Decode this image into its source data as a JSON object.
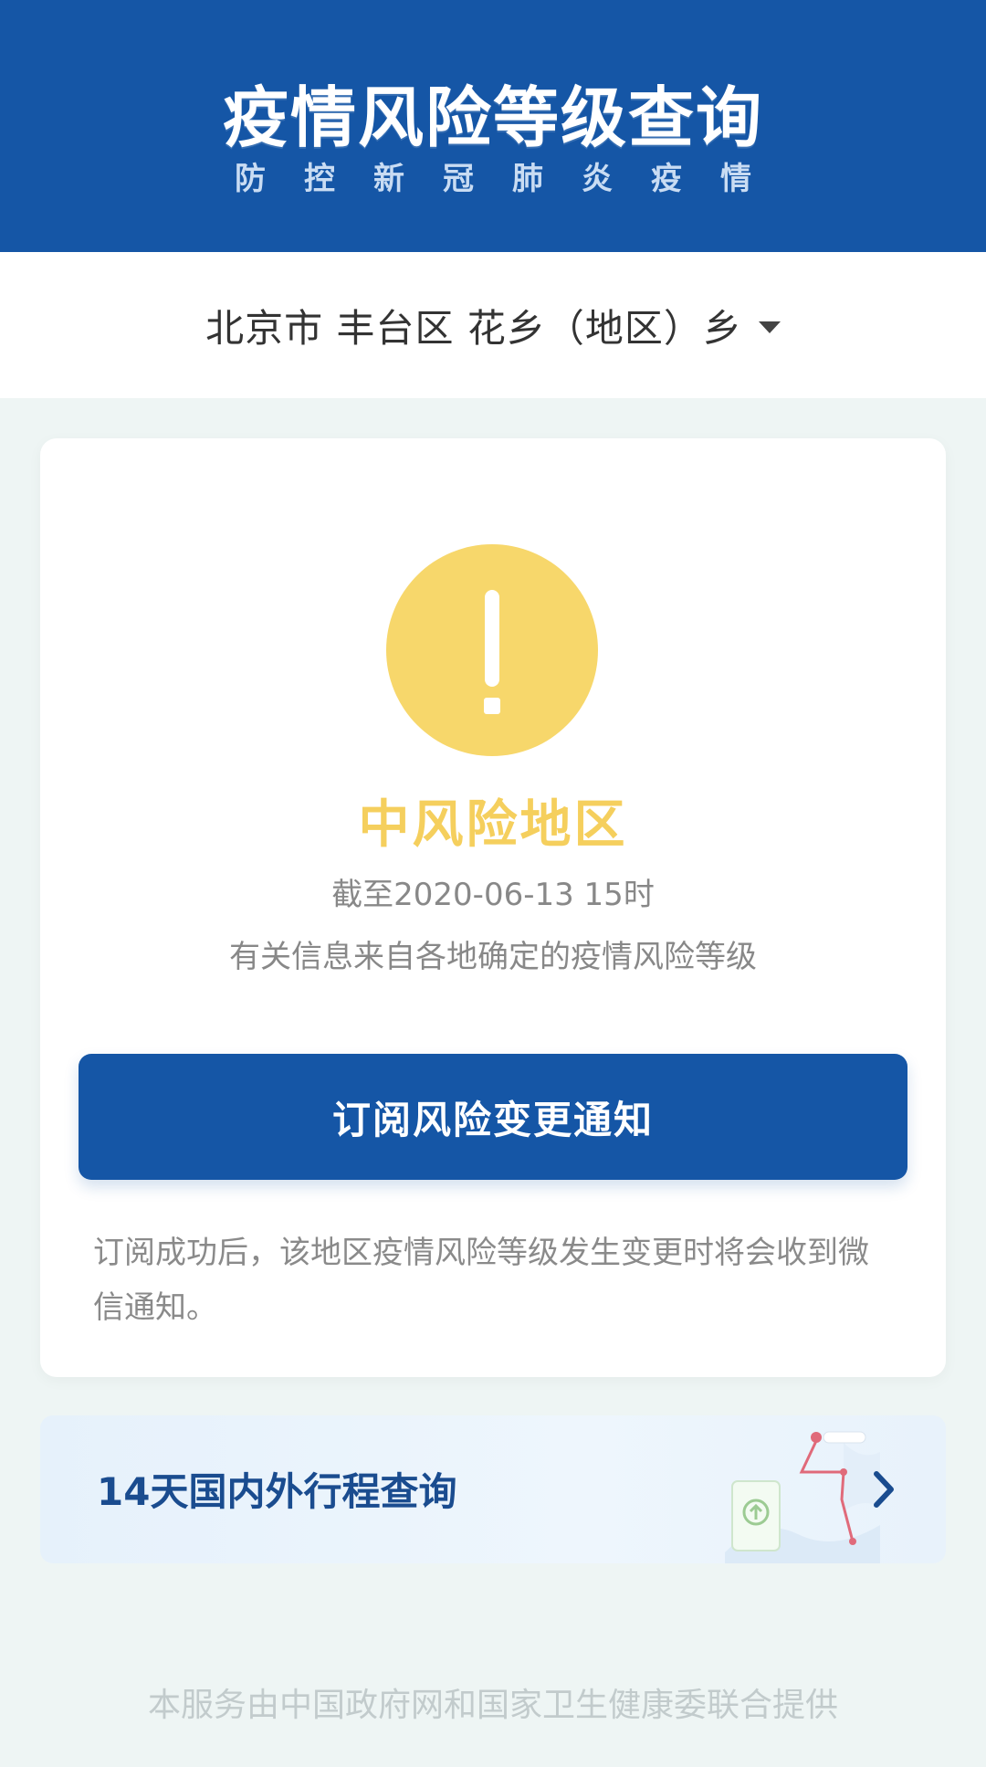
{
  "header": {
    "title": "疫情风险等级查询",
    "subtitle": "防控新冠肺炎疫情"
  },
  "location": {
    "selected": "北京市 丰台区 花乡（地区）乡"
  },
  "risk": {
    "icon": "warning-icon",
    "level": "中风险地区",
    "level_color": "#f5cf5d",
    "as_of": "截至2020-06-13 15时",
    "note": "有关信息来自各地确定的疫情风险等级"
  },
  "subscribe": {
    "button_label": "订阅风险变更通知",
    "hint": "订阅成功后，该地区疫情风险等级发生变更时将会收到微信通知。"
  },
  "travel": {
    "label": "14天国内外行程查询"
  },
  "footer": {
    "credit": "本服务由中国政府网和国家卫生健康委联合提供"
  },
  "colors": {
    "brand_blue": "#1556a6",
    "warning_yellow": "#f7d76b",
    "page_bg": "#eef5f4"
  }
}
